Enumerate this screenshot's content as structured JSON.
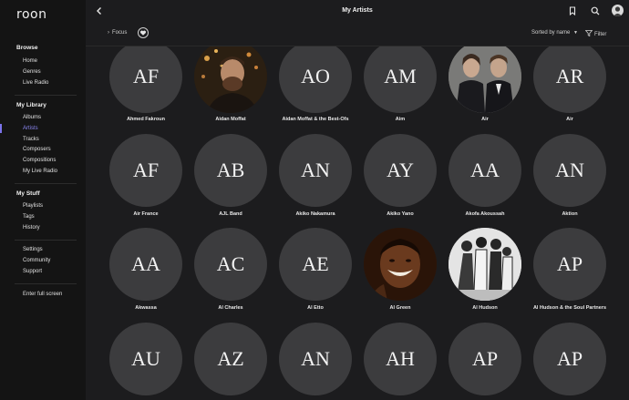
{
  "app": {
    "logo": "roon"
  },
  "sidebar": {
    "sections": [
      {
        "title": "Browse",
        "items": [
          "Home",
          "Genres",
          "Live Radio"
        ]
      },
      {
        "title": "My Library",
        "items": [
          "Albums",
          "Artists",
          "Tracks",
          "Composers",
          "Compositions",
          "My Live Radio"
        ]
      },
      {
        "title": "My Stuff",
        "items": [
          "Playlists",
          "Tags",
          "History"
        ]
      },
      {
        "title": "",
        "items": [
          "Settings",
          "Community",
          "Support"
        ]
      },
      {
        "title": "",
        "items": [
          "Enter full screen"
        ]
      }
    ],
    "active_item": "Artists"
  },
  "header": {
    "title": "My Artists"
  },
  "toolbar": {
    "focus_label": "Focus",
    "sort_label": "Sorted by name",
    "filter_label": "Filter"
  },
  "artists": [
    {
      "name": "Ahmed Fakroun",
      "initials": "AF",
      "photo": false
    },
    {
      "name": "Aidan Moffat",
      "initials": "",
      "photo": true
    },
    {
      "name": "Aidan Moffat & the Best-Ofs",
      "initials": "AO",
      "photo": false
    },
    {
      "name": "Aim",
      "initials": "AM",
      "photo": false
    },
    {
      "name": "Air",
      "initials": "",
      "photo": true
    },
    {
      "name": "Air",
      "initials": "AR",
      "photo": false
    },
    {
      "name": "Air France",
      "initials": "AF",
      "photo": false
    },
    {
      "name": "AJL Band",
      "initials": "AB",
      "photo": false
    },
    {
      "name": "Akiko Nakamura",
      "initials": "AN",
      "photo": false
    },
    {
      "name": "Akiko Yano",
      "initials": "AY",
      "photo": false
    },
    {
      "name": "Akofa Akoussah",
      "initials": "AA",
      "photo": false
    },
    {
      "name": "Aktion",
      "initials": "AN",
      "photo": false
    },
    {
      "name": "Akwassa",
      "initials": "AA",
      "photo": false
    },
    {
      "name": "Al Charles",
      "initials": "AC",
      "photo": false
    },
    {
      "name": "Al Etto",
      "initials": "AE",
      "photo": false
    },
    {
      "name": "Al Green",
      "initials": "",
      "photo": true
    },
    {
      "name": "Al Hudson",
      "initials": "",
      "photo": true
    },
    {
      "name": "Al Hudson & the Soul Partners",
      "initials": "AP",
      "photo": false
    },
    {
      "name": "",
      "initials": "AU",
      "photo": false
    },
    {
      "name": "",
      "initials": "AZ",
      "photo": false
    },
    {
      "name": "",
      "initials": "AN",
      "photo": false
    },
    {
      "name": "",
      "initials": "AH",
      "photo": false
    },
    {
      "name": "",
      "initials": "AP",
      "photo": false
    },
    {
      "name": "",
      "initials": "AP",
      "photo": false
    }
  ],
  "colors": {
    "background": "#1c1c1e",
    "sidebar": "#141414",
    "accent": "#7b73ea",
    "placeholder_circle": "#3c3c3e"
  }
}
